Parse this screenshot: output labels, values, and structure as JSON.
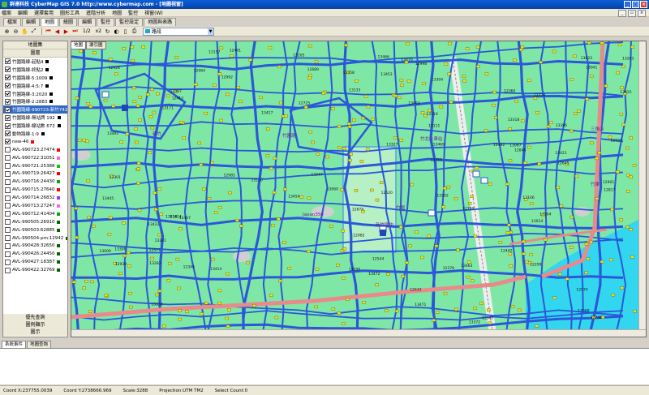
{
  "window": {
    "title": "群達科技  CyberMap GIS 7.0  http://www.cybermap.com - [地圖視窗]"
  },
  "menu": [
    "檔案",
    "編輯",
    "選擇套用",
    "圖形工具",
    "進階分析",
    "地圖",
    "監控",
    "視窗(W)"
  ],
  "tabs": [
    {
      "label": "檔案"
    },
    {
      "label": "編輯"
    },
    {
      "label": "地圖",
      "active": true
    },
    {
      "label": "繪圖"
    },
    {
      "label": "編輯"
    },
    {
      "label": "監控"
    },
    {
      "label": "監控設定"
    },
    {
      "label": "地圖與表路"
    }
  ],
  "toolbar": {
    "page": "1/2",
    "zoom": "x2",
    "layer_name": "路段"
  },
  "left_panel": {
    "title": "地圖集",
    "subtitle": "圖層",
    "layers": [
      {
        "name": "竹園路線-起點4",
        "color": "#000000",
        "checked": true
      },
      {
        "name": "竹園路線-終點2",
        "color": "#000000",
        "checked": true
      },
      {
        "name": "竹園路線-5:1009",
        "color": "#000000",
        "checked": true
      },
      {
        "name": "竹園路線-4:5:7",
        "color": "#000000",
        "checked": true
      },
      {
        "name": "竹園路線-3:2020",
        "color": "#000000",
        "checked": true
      },
      {
        "name": "竹園路線-2:2883",
        "color": "#000000",
        "checked": true
      },
      {
        "name": "竹園路線-990723:新竹742",
        "color": "#000000",
        "checked": true,
        "selected": true
      },
      {
        "name": "竹園路線-無站牌 192",
        "color": "#000000",
        "checked": true
      },
      {
        "name": "竹園路線-線站數 672",
        "color": "#000000",
        "checked": true
      },
      {
        "name": "動物路線-1:9",
        "color": "#000000",
        "checked": true
      },
      {
        "name": "new-46",
        "color": "#ff0000",
        "checked": true
      },
      {
        "name": "AVL-990723:27474",
        "color": "#ff0000",
        "checked": false
      },
      {
        "name": "AVL-990722:31051",
        "color": "#ff66cc",
        "checked": false
      },
      {
        "name": "AVL-990721:25388",
        "color": "#00cc00",
        "checked": false
      },
      {
        "name": "AVL-990719:26427",
        "color": "#ff0000",
        "checked": false
      },
      {
        "name": "AVL-990716:24430",
        "color": "#00aa00",
        "checked": false
      },
      {
        "name": "AVL-990715:27640",
        "color": "#ff0000",
        "checked": false
      },
      {
        "name": "AVL-990714:26832",
        "color": "#9933ff",
        "checked": false
      },
      {
        "name": "AVL-990713:27247",
        "color": "#ff66cc",
        "checked": false
      },
      {
        "name": "AVL-990712:41404",
        "color": "#00aa00",
        "checked": false
      },
      {
        "name": "AVL-990505:26910",
        "color": "#006600",
        "checked": false
      },
      {
        "name": "AVL-990503:62885",
        "color": "#006600",
        "checked": false
      },
      {
        "name": "AVL-990504-pm:12942",
        "color": "#006600",
        "checked": false
      },
      {
        "name": "AVL-990428:32650",
        "color": "#006600",
        "checked": false
      },
      {
        "name": "AVL-990426:24450",
        "color": "#006600",
        "checked": false
      },
      {
        "name": "AVL-990427:18387",
        "color": "#006600",
        "checked": false
      },
      {
        "name": "AVL-990422:32769",
        "color": "#006600",
        "checked": false
      }
    ],
    "buttons": [
      "優先查詢",
      "圖例顯示",
      "圖示"
    ]
  },
  "map": {
    "tabs": [
      {
        "label": "地圖",
        "active": true
      },
      {
        "label": "導引圖"
      }
    ],
    "labels": [
      "竹北火車站",
      "三角店",
      "竹園路",
      "Japan350",
      "新竹國中",
      "竹東",
      "竹園",
      "新竹"
    ],
    "numbers": [
      "13425",
      "13463",
      "13396",
      "13454",
      "13463",
      "13453",
      "13469",
      "13397",
      "13417",
      "13356",
      "13372",
      "13466",
      "13418",
      "13470",
      "13472",
      "13308",
      "13422",
      "13471",
      "13407",
      "13304",
      "13281",
      "13304",
      "13299",
      "13247",
      "13205",
      "13203",
      "13146",
      "13171",
      "13133",
      "13111",
      "13060",
      "13130",
      "13157",
      "13119",
      "13067",
      "13041",
      "13009",
      "12992",
      "12939",
      "12929",
      "12924",
      "12901",
      "12846",
      "12874",
      "12817",
      "12770",
      "12748",
      "12725",
      "12689",
      "12700",
      "12633",
      "12645",
      "12577",
      "12574",
      "12520",
      "12544",
      "12502",
      "12442",
      "12461",
      "12413",
      "12421",
      "12376",
      "12360",
      "12344",
      "12301",
      "12299",
      "13491",
      "13492",
      "13353",
      "13318",
      "13282",
      "13327",
      "13347",
      "13358",
      "13388",
      "13414",
      "13424",
      "13445",
      "12998",
      "12982",
      "12985",
      "12964",
      "13014",
      "13023"
    ]
  },
  "bottom_tabs": [
    {
      "label": "系統事件",
      "active": true
    },
    {
      "label": "地圖查詢"
    }
  ],
  "status": {
    "coord_x": "Coord X:237755.0039",
    "coord_y": "Coord Y:2738666.969",
    "scale": "Scale:3288",
    "projection": "Projection:UTM TM2",
    "select": "Select Count:0"
  }
}
